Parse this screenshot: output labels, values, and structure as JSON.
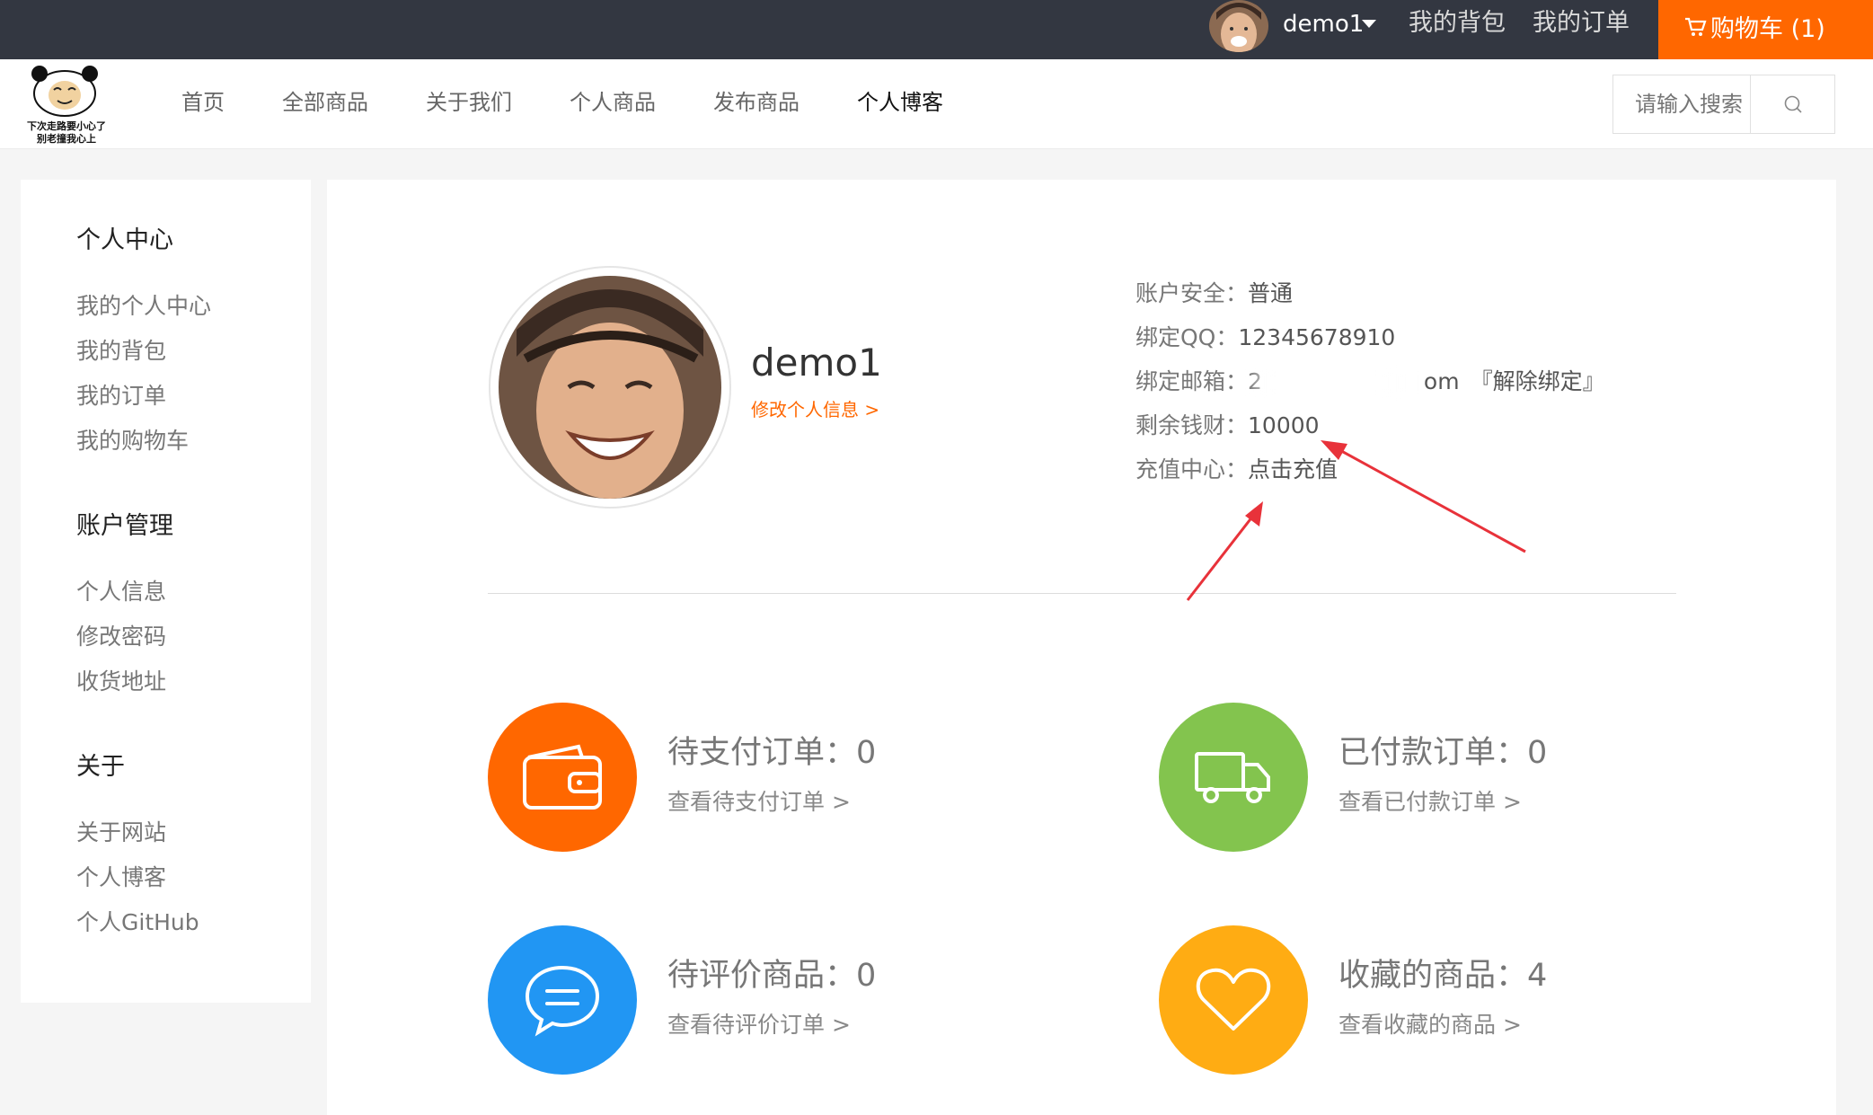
{
  "topbar": {
    "username": "demo1",
    "links": {
      "bag": "我的背包",
      "orders": "我的订单"
    },
    "cart_label": "购物车 (1)"
  },
  "logo": {
    "caption_line1": "下次走路要小心了",
    "caption_line2": "别老撞我心上"
  },
  "nav": {
    "items": [
      "首页",
      "全部商品",
      "关于我们",
      "个人商品",
      "发布商品",
      "个人博客"
    ],
    "active": "个人博客"
  },
  "search": {
    "placeholder": "请输入搜索"
  },
  "sidebar": {
    "groups": [
      {
        "title": "个人中心",
        "items": [
          "我的个人中心",
          "我的背包",
          "我的订单",
          "我的购物车"
        ]
      },
      {
        "title": "账户管理",
        "items": [
          "个人信息",
          "修改密码",
          "收货地址"
        ]
      },
      {
        "title": "关于",
        "items": [
          "关于网站",
          "个人博客",
          "个人GitHub"
        ]
      }
    ]
  },
  "profile": {
    "name": "demo1",
    "edit_link": "修改个人信息 >",
    "info": {
      "security_label": "账户安全：",
      "security_value": "普通",
      "qq_label": "绑定QQ：",
      "qq_value": "12345678910",
      "email_label": "绑定邮箱：",
      "email_start": "2",
      "email_end": "om",
      "email_unbind": "『解除绑定』",
      "money_label": "剩余钱财：",
      "money_value": "10000",
      "recharge_label": "充值中心：",
      "recharge_value": "点击充值"
    }
  },
  "stats": {
    "pending_pay": {
      "label": "待支付订单：0",
      "link": "查看待支付订单 >"
    },
    "paid": {
      "label": "已付款订单：0",
      "link": "查看已付款订单 >"
    },
    "pending_review": {
      "label": "待评价商品：0",
      "link": "查看待评价订单 >"
    },
    "favorites": {
      "label": "收藏的商品：4",
      "link": "查看收藏的商品 >"
    }
  },
  "colors": {
    "topbar": "#333741",
    "accent": "#ff6700",
    "green": "#83c44e",
    "blue": "#2196f3",
    "yellow": "#ffac13",
    "annotation_arrow": "#e8323a"
  }
}
